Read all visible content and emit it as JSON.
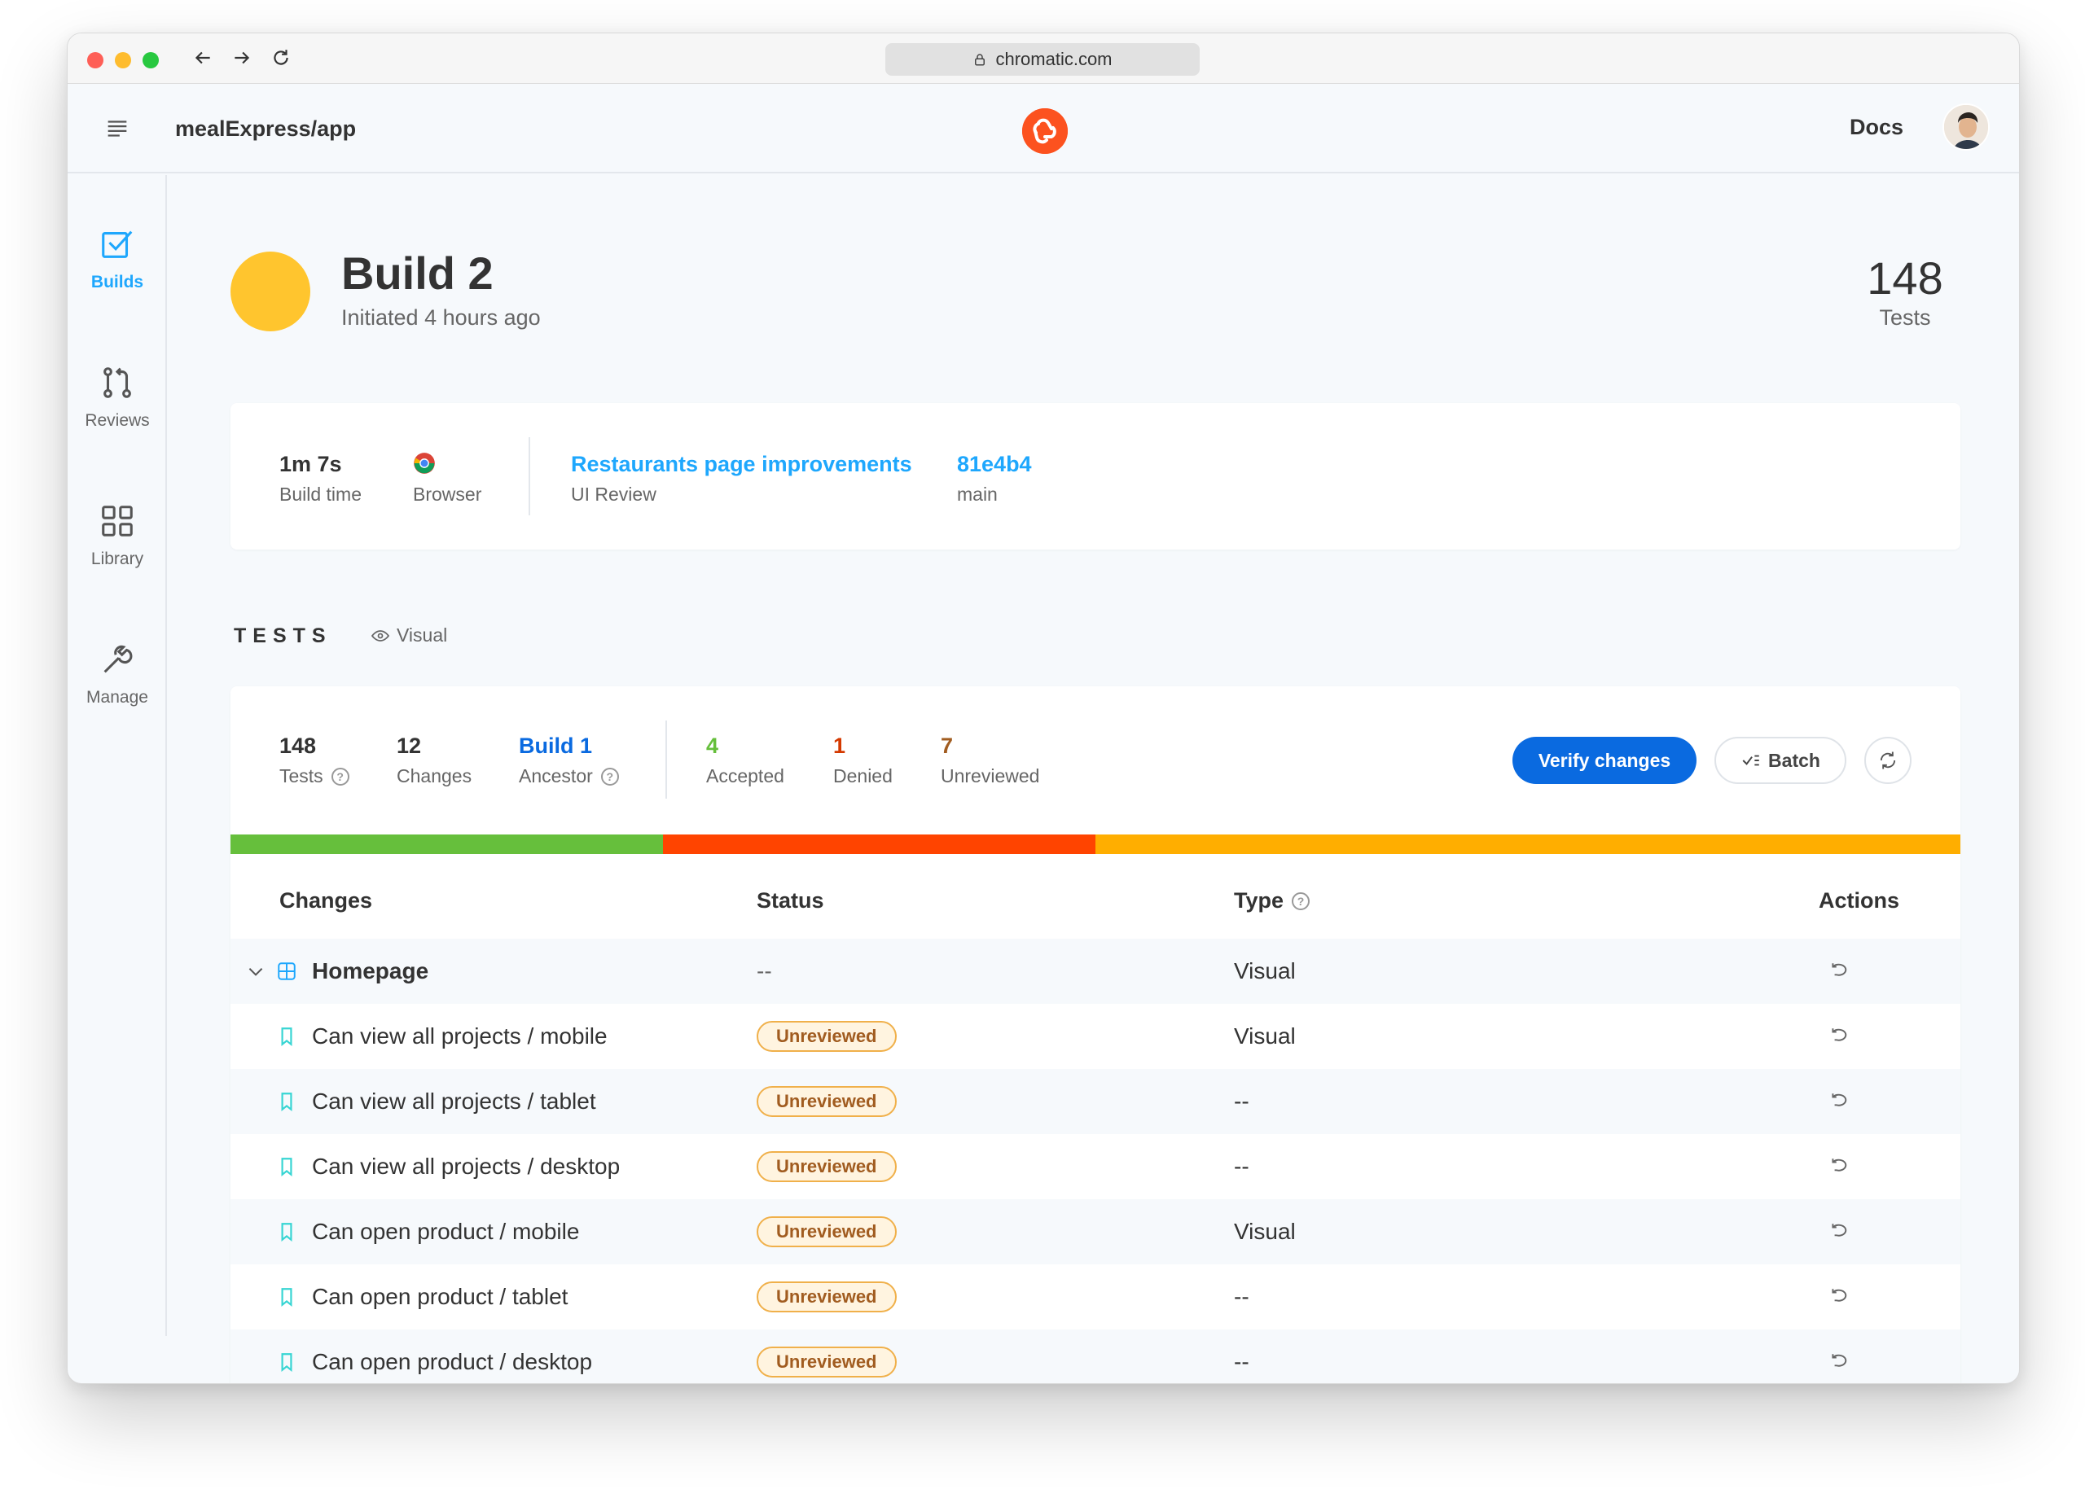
{
  "browser": {
    "url": "chromatic.com"
  },
  "header": {
    "repo": "mealExpress/app",
    "docs_label": "Docs"
  },
  "sidebar": {
    "items": [
      {
        "label": "Builds"
      },
      {
        "label": "Reviews"
      },
      {
        "label": "Library"
      },
      {
        "label": "Manage"
      }
    ]
  },
  "build": {
    "title": "Build 2",
    "subtitle": "Initiated 4 hours ago",
    "tests_count": "148",
    "tests_label": "Tests"
  },
  "info": {
    "build_time_value": "1m 7s",
    "build_time_label": "Build time",
    "browser_label": "Browser",
    "pr_title": "Restaurants page improvements",
    "pr_label": "UI Review",
    "commit": "81e4b4",
    "branch": "main"
  },
  "tests_section": {
    "heading": "TESTS",
    "visual_label": "Visual"
  },
  "summary": {
    "tests_value": "148",
    "tests_label": "Tests",
    "changes_value": "12",
    "changes_label": "Changes",
    "ancestor_value": "Build 1",
    "ancestor_label": "Ancestor",
    "accepted_value": "4",
    "accepted_label": "Accepted",
    "denied_value": "1",
    "denied_label": "Denied",
    "unreviewed_value": "7",
    "unreviewed_label": "Unreviewed",
    "verify_label": "Verify changes",
    "batch_label": "Batch"
  },
  "progress": [
    {
      "status": "accepted",
      "fraction": 0.25,
      "color": "#66bf3c"
    },
    {
      "status": "denied",
      "fraction": 0.25,
      "color": "#ff4400"
    },
    {
      "status": "unreviewed",
      "fraction": 0.5,
      "color": "#ffae00"
    }
  ],
  "table": {
    "headers": {
      "changes": "Changes",
      "status": "Status",
      "type": "Type",
      "actions": "Actions"
    },
    "group": {
      "name": "Homepage",
      "status": "--",
      "type": "Visual"
    },
    "rows": [
      {
        "name": "Can view all projects / mobile",
        "status": "Unreviewed",
        "type": "Visual"
      },
      {
        "name": "Can view all projects / tablet",
        "status": "Unreviewed",
        "type": "--"
      },
      {
        "name": "Can view all projects / desktop",
        "status": "Unreviewed",
        "type": "--"
      },
      {
        "name": "Can open product / mobile",
        "status": "Unreviewed",
        "type": "Visual"
      },
      {
        "name": "Can open product / tablet",
        "status": "Unreviewed",
        "type": "--"
      },
      {
        "name": "Can open product / desktop",
        "status": "Unreviewed",
        "type": "--"
      }
    ]
  }
}
